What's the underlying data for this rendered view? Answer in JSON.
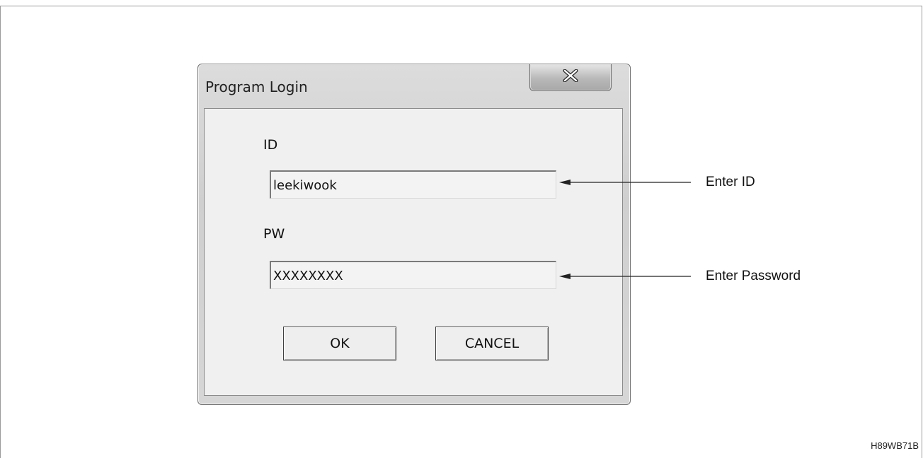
{
  "dialog": {
    "title": "Program Login",
    "close_icon": "close-x-icon",
    "id_label": "ID",
    "id_value": "leekiwook",
    "pw_label": "PW",
    "pw_value": "XXXXXXXX",
    "ok_label": "OK",
    "cancel_label": "CANCEL"
  },
  "annotations": {
    "id_callout": "Enter ID",
    "pw_callout": "Enter Password"
  },
  "figure_code": "H89WB71B"
}
